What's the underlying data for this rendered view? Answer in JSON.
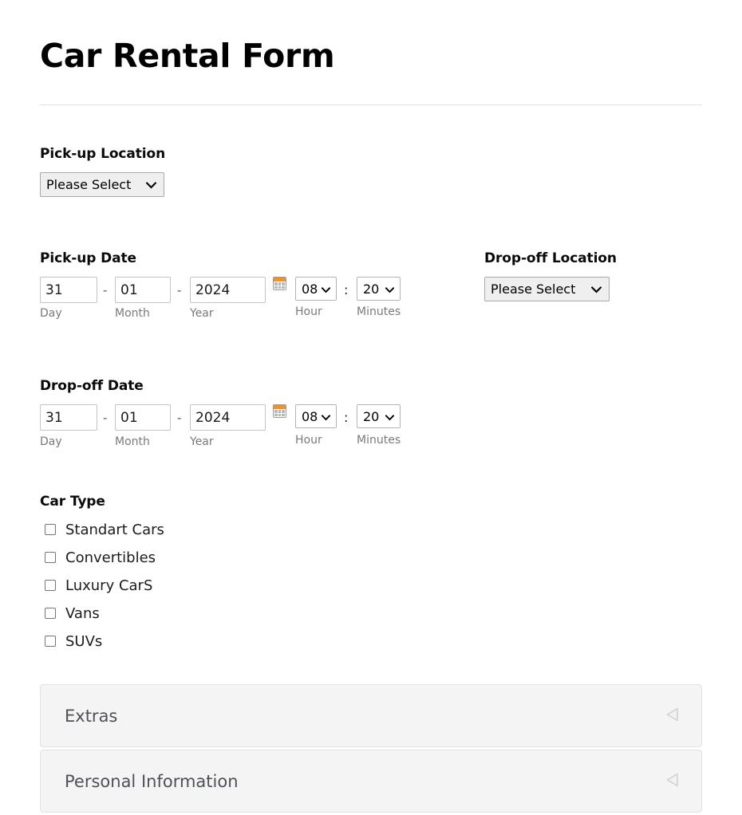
{
  "page": {
    "title": "Car Rental Form"
  },
  "pickup_location": {
    "label": "Pick-up Location",
    "selected": "Please Select",
    "options": [
      "Please Select"
    ]
  },
  "dropoff_location": {
    "label": "Drop-off Location",
    "selected": "Please Select",
    "options": [
      "Please Select"
    ]
  },
  "pickup_date": {
    "label": "Pick-up Date",
    "day": "31",
    "month": "01",
    "year": "2024",
    "separator": "-",
    "day_sublabel": "Day",
    "month_sublabel": "Month",
    "year_sublabel": "Year",
    "hour": "08",
    "minutes": "20",
    "time_separator": ":",
    "hour_sublabel": "Hour",
    "minutes_sublabel": "Minutes",
    "calendar_icon": "calendar-icon"
  },
  "dropoff_date": {
    "label": "Drop-off Date",
    "day": "31",
    "month": "01",
    "year": "2024",
    "separator": "-",
    "day_sublabel": "Day",
    "month_sublabel": "Month",
    "year_sublabel": "Year",
    "hour": "08",
    "minutes": "20",
    "time_separator": ":",
    "hour_sublabel": "Hour",
    "minutes_sublabel": "Minutes",
    "calendar_icon": "calendar-icon"
  },
  "car_type": {
    "label": "Car Type",
    "options": [
      {
        "label": "Standart Cars",
        "checked": false
      },
      {
        "label": "Convertibles",
        "checked": false
      },
      {
        "label": "Luxury CarS",
        "checked": false
      },
      {
        "label": "Vans",
        "checked": false
      },
      {
        "label": "SUVs",
        "checked": false
      }
    ]
  },
  "panels": [
    {
      "title": "Extras",
      "state": "collapsed",
      "arrow_icon": "triangle-left-icon"
    },
    {
      "title": "Personal Information",
      "state": "collapsed",
      "arrow_icon": "triangle-left-icon"
    }
  ],
  "colors": {
    "accent_orange": "#f0922b",
    "panel_background": "#f4f4f4",
    "select_background": "#efefef",
    "rule": "#e0e0e0"
  }
}
